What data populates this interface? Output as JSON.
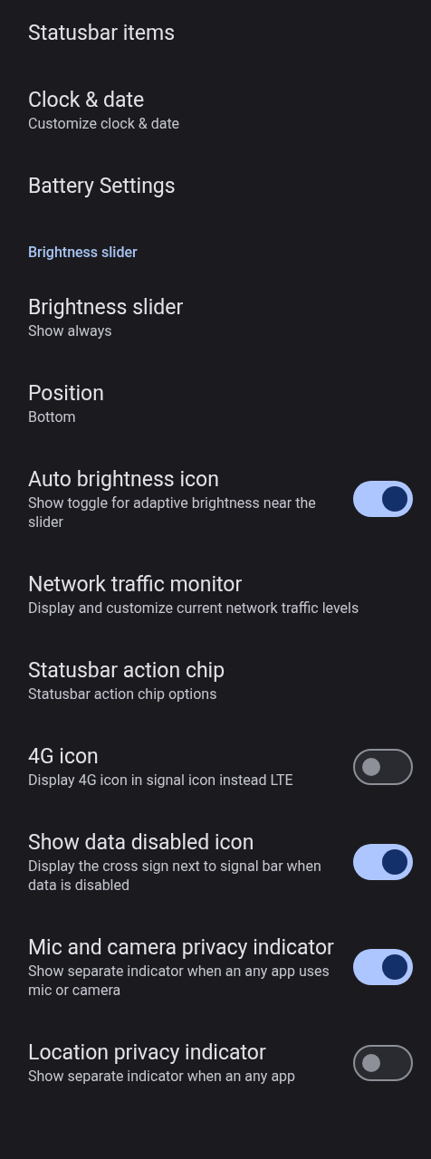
{
  "items": [
    {
      "kind": "link",
      "title": "Statusbar items"
    },
    {
      "kind": "link",
      "title": "Clock & date",
      "summary": "Customize clock & date"
    },
    {
      "kind": "link",
      "title": "Battery Settings"
    },
    {
      "kind": "header",
      "title": "Brightness slider"
    },
    {
      "kind": "link",
      "title": "Brightness slider",
      "summary": "Show always"
    },
    {
      "kind": "link",
      "title": "Position",
      "summary": "Bottom"
    },
    {
      "kind": "toggle",
      "title": "Auto brightness icon",
      "summary": "Show toggle for adaptive brightness near the slider",
      "on": true
    },
    {
      "kind": "link",
      "title": "Network traffic monitor",
      "summary": "Display and customize current network traffic levels"
    },
    {
      "kind": "link",
      "title": "Statusbar action chip",
      "summary": "Statusbar action chip options"
    },
    {
      "kind": "toggle",
      "title": "4G icon",
      "summary": "Display 4G icon in signal icon instead LTE",
      "on": false
    },
    {
      "kind": "toggle",
      "title": "Show data disabled icon",
      "summary": "Display the cross sign next to signal bar when data is disabled",
      "on": true
    },
    {
      "kind": "toggle",
      "title": "Mic and camera privacy indicator",
      "summary": "Show separate indicator when an any app uses mic or camera",
      "on": true
    },
    {
      "kind": "toggle",
      "title": "Location privacy indicator",
      "summary": "Show separate indicator when an any app",
      "on": false
    }
  ]
}
